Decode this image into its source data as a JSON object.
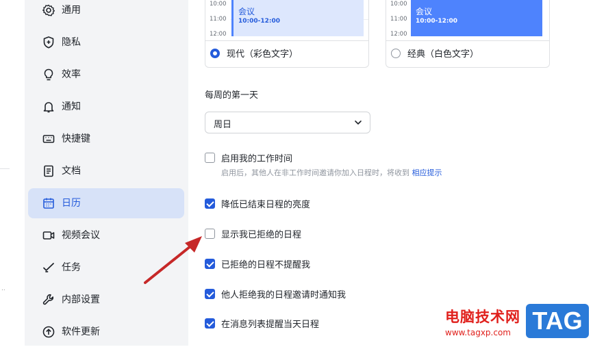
{
  "sidebar": {
    "items": [
      {
        "label": "通用",
        "icon": "gear-icon"
      },
      {
        "label": "隐私",
        "icon": "shield-icon"
      },
      {
        "label": "效率",
        "icon": "lightbulb-icon"
      },
      {
        "label": "通知",
        "icon": "bell-icon"
      },
      {
        "label": "快捷键",
        "icon": "keyboard-icon"
      },
      {
        "label": "文档",
        "icon": "document-icon"
      },
      {
        "label": "日历",
        "icon": "calendar-icon",
        "active": true
      },
      {
        "label": "视频会议",
        "icon": "video-icon"
      },
      {
        "label": "任务",
        "icon": "check-icon"
      },
      {
        "label": "内部设置",
        "icon": "wrench-icon"
      },
      {
        "label": "软件更新",
        "icon": "arrow-up-circle-icon"
      }
    ]
  },
  "theme_cards": {
    "times": [
      "10:00",
      "11:00",
      "12:00"
    ],
    "modern": {
      "event_title": "会议",
      "event_time": "10:00-12:00",
      "option_label": "现代（彩色文字）",
      "selected": true
    },
    "classic": {
      "event_title": "会议",
      "event_time": "10:00-12:00",
      "option_label": "经典（白色文字）",
      "selected": false
    }
  },
  "week_start": {
    "label": "每周的第一天",
    "value": "周日"
  },
  "working_hours": {
    "label": "启用我的工作时间",
    "checked": false,
    "hint": "启用后，其他人在非工作时间邀请你加入日程时，将收到",
    "hint_link": "相应提示"
  },
  "options": [
    {
      "label": "降低已结束日程的亮度",
      "checked": true
    },
    {
      "label": "显示我已拒绝的日程",
      "checked": false
    },
    {
      "label": "已拒绝的日程不提醒我",
      "checked": true
    },
    {
      "label": "他人拒绝我的日程邀请时通知我",
      "checked": true
    },
    {
      "label": "在消息列表提醒当天日程",
      "checked": true
    }
  ],
  "watermark": {
    "site_name": "电脑技术网",
    "url": "www.tagxp.com",
    "badge": "TAG"
  },
  "colors": {
    "accent": "#245bdb",
    "event_light": "#dde7fd",
    "event_solid": "#4e83fd",
    "sidebar_bg": "#f3f4f6",
    "sidebar_active": "#d7e2f8",
    "arrow": "#c62828"
  }
}
